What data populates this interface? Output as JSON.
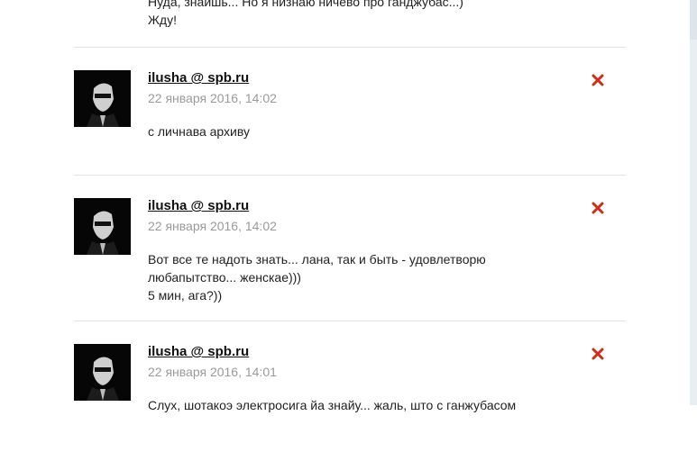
{
  "top_text": {
    "line1": "Нуда, знаишь... Но я низнаю ничево про ганджубас...)",
    "line2": "Жду!"
  },
  "comments": [
    {
      "author": "ilusha @ spb.ru",
      "date": "22 января 2016, 14:02",
      "lines": [
        "с личнава архиву"
      ],
      "delete_icon": "close-icon"
    },
    {
      "author": "ilusha @ spb.ru",
      "date": "22 января 2016, 14:02",
      "lines": [
        "Вот все те надоть знать... лана, так и быть - удовлетворю",
        "любапытство... женскае)))",
        "5 мин, ага?))"
      ],
      "delete_icon": "close-icon"
    },
    {
      "author": "ilusha @ spb.ru",
      "date": "22 января 2016, 14:01",
      "lines": [
        "Слух, шотакоэ электросига йа знайу... жаль, што с ганжубасом"
      ],
      "delete_icon": "close-icon"
    }
  ],
  "colors": {
    "delete": "#d42a1a",
    "date": "#9a9a9a",
    "separator": "#e3e3e3"
  }
}
